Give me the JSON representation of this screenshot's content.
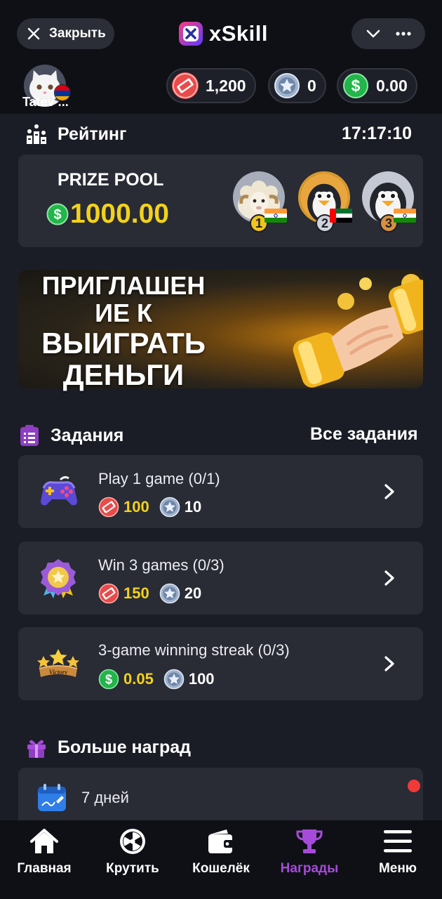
{
  "header": {
    "close_label": "Закрыть",
    "brand": "xSkill",
    "icons": [
      "close-icon",
      "chevron-down-icon",
      "more-dots-icon"
    ]
  },
  "profile": {
    "name": "Tatev ...",
    "flag": "armenia-flag-icon"
  },
  "balances": [
    {
      "name": "tickets",
      "icon": "ticket-coin-icon",
      "value": "1,200",
      "color": "#e84b4b"
    },
    {
      "name": "stars",
      "icon": "star-coin-icon",
      "value": "0",
      "color": "#9fb2cc"
    },
    {
      "name": "cash",
      "icon": "dollar-coin-icon",
      "value": "0.00",
      "color": "#22b54a"
    }
  ],
  "rating": {
    "title": "Рейтинг",
    "timer": "17:17:10",
    "prize_pool_label": "PRIZE POOL",
    "prize_pool_amount": "1000.00",
    "winners": [
      {
        "rank": "1",
        "avatar": "sheep-avatar",
        "flag": "india-flag-icon"
      },
      {
        "rank": "2",
        "avatar": "penguin-avatar",
        "flag": "uae-flag-icon"
      },
      {
        "rank": "3",
        "avatar": "penguin-avatar",
        "flag": "india-flag-icon"
      }
    ]
  },
  "banner": {
    "line1": "ПРИГЛАШЕН",
    "line2": "ИЕ К",
    "line3": "ВЫИГРАТЬ",
    "line4": "ДЕНЬГИ",
    "image": "gold-handshake-icon"
  },
  "tasks": {
    "title": "Задания",
    "all_link": "Все задания",
    "items": [
      {
        "title": "Play 1 game (0/1)",
        "icon": "gamepad-icon",
        "reward_primary": "100",
        "reward_primary_icon": "ticket-coin-icon",
        "reward_secondary": "10",
        "reward_secondary_icon": "star-coin-icon"
      },
      {
        "title": "Win 3 games (0/3)",
        "icon": "medal-icon",
        "reward_primary": "150",
        "reward_primary_icon": "ticket-coin-icon",
        "reward_secondary": "20",
        "reward_secondary_icon": "star-coin-icon"
      },
      {
        "title": "3-game winning streak (0/3)",
        "icon": "victory-stars-icon",
        "reward_primary": "0.05",
        "reward_primary_icon": "dollar-coin-icon",
        "reward_secondary": "100",
        "reward_secondary_icon": "star-coin-icon"
      }
    ]
  },
  "more_rewards": {
    "title": "Больше наград",
    "seven_days": "7 дней"
  },
  "nav": {
    "items": [
      {
        "label": "Главная",
        "icon": "home-icon",
        "active": false
      },
      {
        "label": "Крутить",
        "icon": "wheel-icon",
        "active": false
      },
      {
        "label": "Кошелёк",
        "icon": "wallet-icon",
        "active": false
      },
      {
        "label": "Награды",
        "icon": "trophy-icon",
        "active": true
      },
      {
        "label": "Меню",
        "icon": "hamburger-icon",
        "active": false
      }
    ]
  },
  "colors": {
    "background": "#1b1d26",
    "card": "#292b35",
    "accent_gold": "#f2d21b",
    "accent_purple": "#a64bd9"
  }
}
